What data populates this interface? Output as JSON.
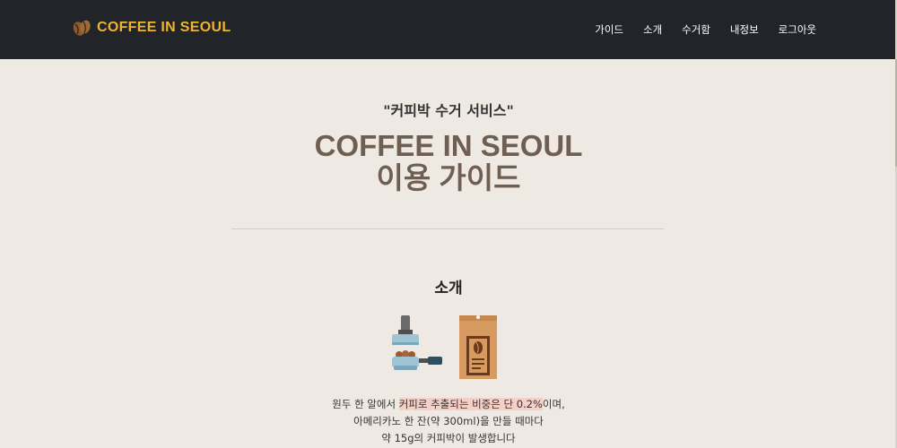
{
  "navbar": {
    "brand": "COFFEE IN SEOUL",
    "brand_icon": "coffee-bean-icon",
    "links": [
      "가이드",
      "소개",
      "수거함",
      "내정보",
      "로그아웃"
    ]
  },
  "hero": {
    "quote": "\"커피박 수거 서비스\"",
    "title_line1": "COFFEE IN SEOUL",
    "title_line2": "이용 가이드"
  },
  "intro": {
    "heading": "소개",
    "illustration_icons": [
      "coffee-tamper-icon",
      "portafilter-icon",
      "coffee-bag-icon"
    ],
    "line1_pre": "원두 한 알에서 ",
    "line1_highlight": "커피로 추출되는 비중은 단 0.2%",
    "line1_post": "이며,",
    "line2": "아메리카노 한 잔(약 300ml)을 만들 때마다",
    "line3": "약 15g의 커피박이 발생합니다"
  },
  "colors": {
    "navbar_bg": "#212529",
    "brand": "#f0b52c",
    "page_bg": "#efe9e4",
    "title": "#6e5f52",
    "highlight": "#f6cfc6"
  }
}
